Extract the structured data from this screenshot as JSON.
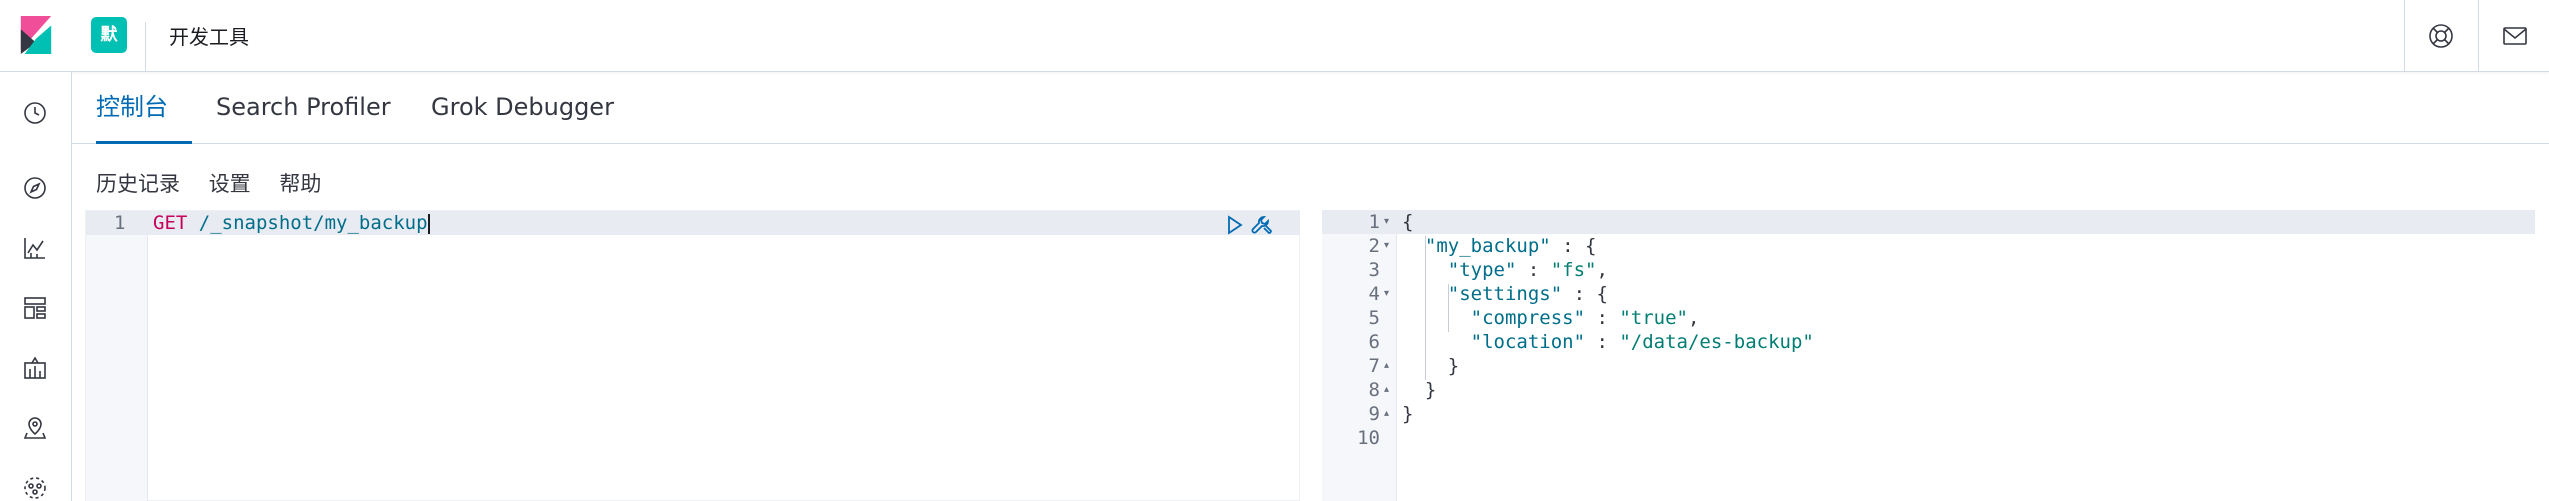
{
  "header": {
    "space_badge": "默",
    "app_title": "开发工具"
  },
  "tabs": [
    {
      "label": "控制台",
      "active": true
    },
    {
      "label": "Search Profiler",
      "active": false
    },
    {
      "label": "Grok Debugger",
      "active": false
    }
  ],
  "toolbar": {
    "history": "历史记录",
    "settings": "设置",
    "help": "帮助"
  },
  "request": {
    "line_number": "1",
    "method": "GET",
    "path": "/_snapshot/my_backup"
  },
  "response": {
    "line_numbers": [
      "1",
      "2",
      "3",
      "4",
      "5",
      "6",
      "7",
      "8",
      "9",
      "10"
    ],
    "lines": [
      {
        "parts": [
          [
            "jp",
            "{"
          ]
        ]
      },
      {
        "parts": [
          [
            "jp",
            "  "
          ],
          [
            "jkey",
            "\"my_backup\""
          ],
          [
            "jp",
            " : {"
          ]
        ]
      },
      {
        "parts": [
          [
            "jp",
            "    "
          ],
          [
            "jkey",
            "\"type\""
          ],
          [
            "jp",
            " : "
          ],
          [
            "jstr",
            "\"fs\""
          ],
          [
            "jp",
            ","
          ]
        ]
      },
      {
        "parts": [
          [
            "jp",
            "    "
          ],
          [
            "jkey",
            "\"settings\""
          ],
          [
            "jp",
            " : {"
          ]
        ]
      },
      {
        "parts": [
          [
            "jp",
            "      "
          ],
          [
            "jkey",
            "\"compress\""
          ],
          [
            "jp",
            " : "
          ],
          [
            "jstr",
            "\"true\""
          ],
          [
            "jp",
            ","
          ]
        ]
      },
      {
        "parts": [
          [
            "jp",
            "      "
          ],
          [
            "jkey",
            "\"location\""
          ],
          [
            "jp",
            " : "
          ],
          [
            "jstr",
            "\"/data/es-backup\""
          ]
        ]
      },
      {
        "parts": [
          [
            "jp",
            "    }"
          ]
        ]
      },
      {
        "parts": [
          [
            "jp",
            "  }"
          ]
        ]
      },
      {
        "parts": [
          [
            "jp",
            "}"
          ]
        ]
      },
      {
        "parts": [
          [
            "jp",
            ""
          ]
        ]
      }
    ]
  },
  "colors": {
    "accent": "#006bb4",
    "space_badge": "#00bfb3",
    "json_key": "#006e8a",
    "json_string": "#017d73",
    "method": "#c6005a"
  },
  "icons": {
    "header_right": [
      "help-icon",
      "mail-icon"
    ],
    "nav": [
      "clock-icon",
      "compass-icon",
      "visualize-icon",
      "dashboard-icon",
      "canvas-icon",
      "maps-icon",
      "ml-icon"
    ],
    "request_actions": [
      "play-icon",
      "wrench-icon"
    ]
  }
}
